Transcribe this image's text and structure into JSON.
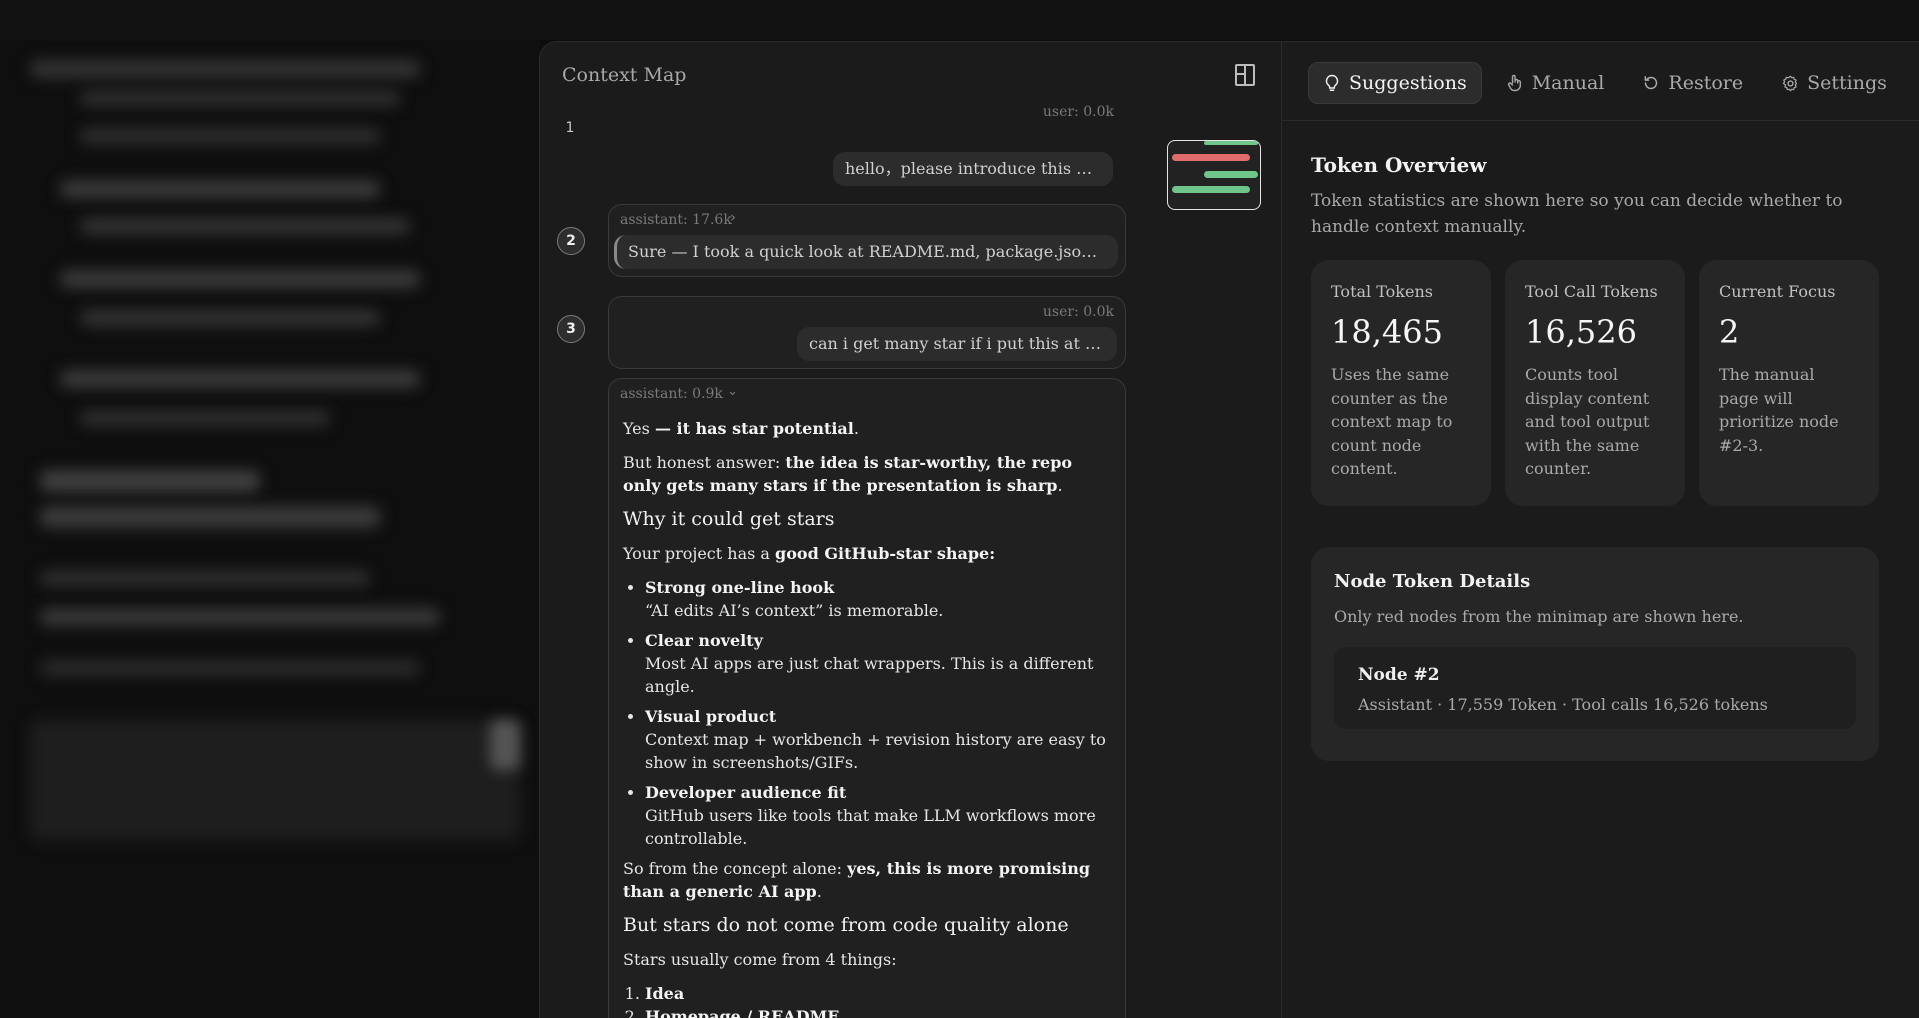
{
  "context_map": {
    "title": "Context Map",
    "messages": [
      {
        "num": "1",
        "meta": "user: 0.0k",
        "text": "hello，please introduce this project"
      },
      {
        "num": "2",
        "meta": "assistant: 17.6k",
        "chevron": "›",
        "text": "Sure — I took a quick look at README.md, package.json, websocket..."
      },
      {
        "num": "3",
        "meta": "user: 0.0k",
        "text": "can i get many star if i put this at github?"
      },
      {
        "meta": "assistant: 0.9k",
        "chevron": "⌄"
      }
    ],
    "message4": {
      "p1_pre": "Yes ",
      "p1_bold": "— it has star potential",
      "p1_post": ".",
      "p2_pre": "But honest answer: ",
      "p2_bold": "the idea is star-worthy, the repo only gets many stars if the presentation is sharp",
      "p2_post": ".",
      "h1": "Why it could get stars",
      "p3_pre": "Your project has a ",
      "p3_bold": "good GitHub-star shape:",
      "bullets": [
        {
          "title": "Strong one-line hook",
          "text": "“AI edits AI’s context” is memorable."
        },
        {
          "title": "Clear novelty",
          "text": "Most AI apps are just chat wrappers. This is a different angle."
        },
        {
          "title": "Visual product",
          "text": "Context map + workbench + revision history are easy to show in screenshots/GIFs."
        },
        {
          "title": "Developer audience fit",
          "text": "GitHub users like tools that make LLM workflows more controllable."
        }
      ],
      "p4_pre": "So from the concept alone: ",
      "p4_bold": "yes, this is more promising than a generic AI app",
      "p4_post": ".",
      "h2": "But stars do not come from code quality alone",
      "p5": "Stars usually come from 4 things:",
      "ol": [
        "Idea",
        "Homepage / README"
      ]
    }
  },
  "tabs": [
    {
      "label": "Suggestions",
      "icon": "lightbulb-icon",
      "active": true
    },
    {
      "label": "Manual",
      "icon": "hand-pointer-icon",
      "active": false
    },
    {
      "label": "Restore",
      "icon": "restore-icon",
      "active": false
    },
    {
      "label": "Settings",
      "icon": "gear-icon",
      "active": false
    }
  ],
  "overview": {
    "title": "Token Overview",
    "description": "Token statistics are shown here so you can decide whether to handle context manually.",
    "stats": [
      {
        "label": "Total Tokens",
        "value": "18,465",
        "desc": "Uses the same counter as the context map to count node content."
      },
      {
        "label": "Tool Call Tokens",
        "value": "16,526",
        "desc": "Counts tool display content and tool output with the same counter."
      },
      {
        "label": "Current Focus",
        "value": "2",
        "desc": "The manual page will prioritize node #2-3."
      }
    ]
  },
  "details": {
    "title": "Node Token Details",
    "subtitle": "Only red nodes from the minimap are shown here.",
    "node_title": "Node #2",
    "node_sub": "Assistant · 17,559 Token · Tool calls 16,526 tokens"
  },
  "colors": {
    "minimap_red": "#e06c6c",
    "minimap_green": "#6fc58a"
  }
}
